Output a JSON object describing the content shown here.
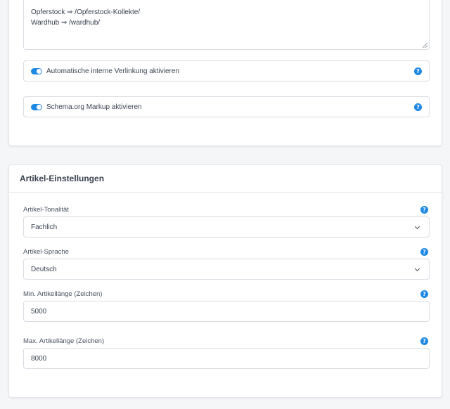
{
  "redirects": {
    "lines": [
      "Opferstock ⇒ /Opferstock-Kollekte/",
      "Wardhub ⇒ /wardhub/"
    ]
  },
  "toggles": [
    {
      "label": "Automatische interne Verlinkung aktivieren",
      "enabled": true
    },
    {
      "label": "Schema.org Markup aktivieren",
      "enabled": true
    }
  ],
  "help_glyph": "?",
  "article_settings": {
    "title": "Artikel-Einstellungen",
    "tonality": {
      "label": "Artikel-Tonalität",
      "value": "Fachlich"
    },
    "language": {
      "label": "Artikel-Sprache",
      "value": "Deutsch"
    },
    "min_length": {
      "label": "Min. Artikellänge (Zeichen)",
      "value": "5000"
    },
    "max_length": {
      "label": "Max. Artikellänge (Zeichen)",
      "value": "8000"
    }
  },
  "colors": {
    "accent": "#1e88e5",
    "background": "#f5f6f8",
    "text": "#3a4250"
  }
}
